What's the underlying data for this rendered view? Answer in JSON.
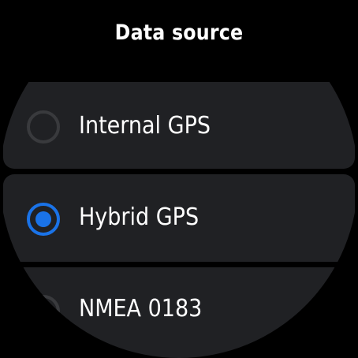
{
  "header": {
    "title": "Data source"
  },
  "options": [
    {
      "label": "Internal GPS",
      "selected": false
    },
    {
      "label": "Hybrid GPS",
      "selected": true
    },
    {
      "label": "NMEA 0183",
      "selected": false
    }
  ],
  "colors": {
    "background": "#000000",
    "card": "#202124",
    "accent": "#1a73e8",
    "radio_unselected": "#393a3d",
    "text": "#ffffff"
  }
}
